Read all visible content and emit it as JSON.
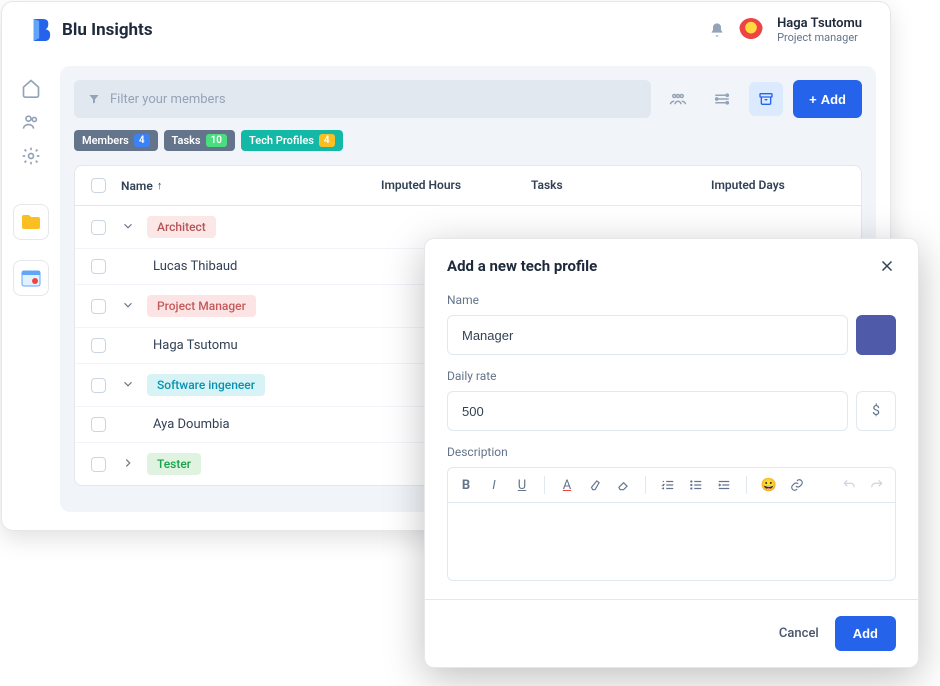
{
  "header": {
    "app_name": "Blu Insights",
    "user_name": "Haga Tsutomu",
    "user_role": "Project manager"
  },
  "toolbar": {
    "filter_placeholder": "Filter your members",
    "add_label": "Add"
  },
  "chips": {
    "members_label": "Members",
    "members_count": "4",
    "tasks_label": "Tasks",
    "tasks_count": "10",
    "tech_label": "Tech Profiles",
    "tech_count": "4"
  },
  "table": {
    "headers": {
      "name": "Name",
      "hours": "Imputed Hours",
      "tasks": "Tasks",
      "days": "Imputed Days"
    },
    "rows": [
      {
        "type": "group",
        "label": "Architect",
        "tag_class": "tag-pink",
        "expanded": true
      },
      {
        "type": "member",
        "label": "Lucas Thibaud"
      },
      {
        "type": "group",
        "label": "Project Manager",
        "tag_class": "tag-pink2",
        "expanded": true
      },
      {
        "type": "member",
        "label": "Haga Tsutomu"
      },
      {
        "type": "group",
        "label": "Software ingeneer",
        "tag_class": "tag-cyan",
        "expanded": true
      },
      {
        "type": "member",
        "label": "Aya Doumbia"
      },
      {
        "type": "group",
        "label": "Tester",
        "tag_class": "tag-green",
        "expanded": false
      }
    ]
  },
  "modal": {
    "title": "Add a new tech profile",
    "name_label": "Name",
    "name_value": "Manager",
    "rate_label": "Daily rate",
    "rate_value": "500",
    "rate_unit": "$",
    "desc_label": "Description",
    "cancel_label": "Cancel",
    "add_label": "Add"
  }
}
